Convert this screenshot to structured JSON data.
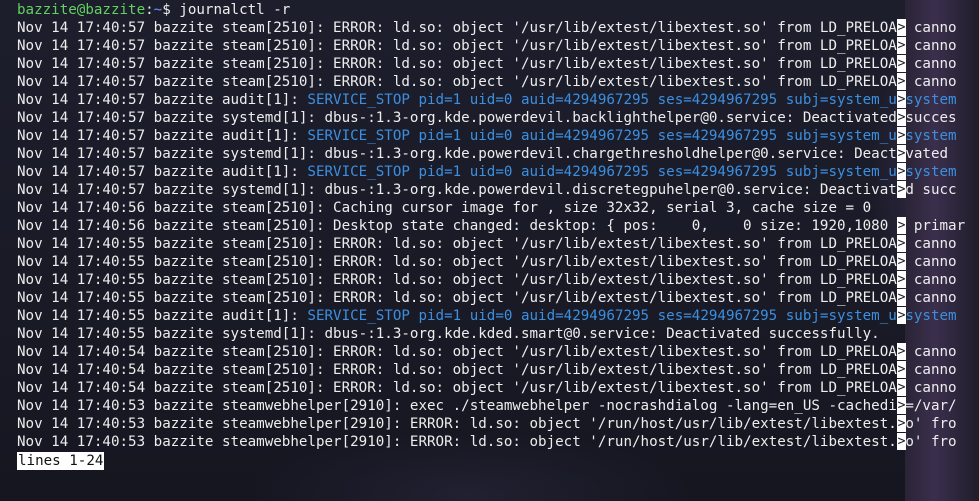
{
  "prompt": {
    "user_host": "bazzite@bazzite",
    "separator": ":",
    "path": "~",
    "symbol": "$",
    "command": " journalctl -r"
  },
  "truncation_marker": ">",
  "log_lines": [
    {
      "prefix": "Nov 14 17:40:57 bazzite steam[2510]: ",
      "message": "ERROR: ld.so: object '/usr/lib/extest/libextest.so' from LD_PRELOAD canno",
      "highlight": false
    },
    {
      "prefix": "Nov 14 17:40:57 bazzite steam[2510]: ",
      "message": "ERROR: ld.so: object '/usr/lib/extest/libextest.so' from LD_PRELOAD canno",
      "highlight": false
    },
    {
      "prefix": "Nov 14 17:40:57 bazzite steam[2510]: ",
      "message": "ERROR: ld.so: object '/usr/lib/extest/libextest.so' from LD_PRELOAD canno",
      "highlight": false
    },
    {
      "prefix": "Nov 14 17:40:57 bazzite steam[2510]: ",
      "message": "ERROR: ld.so: object '/usr/lib/extest/libextest.so' from LD_PRELOAD canno",
      "highlight": false
    },
    {
      "prefix": "Nov 14 17:40:57 bazzite audit[1]: ",
      "message": "SERVICE_STOP pid=1 uid=0 auid=4294967295 ses=4294967295 subj=system_u:system",
      "highlight": true
    },
    {
      "prefix": "Nov 14 17:40:57 bazzite systemd[1]: ",
      "message": "dbus-:1.3-org.kde.powerdevil.backlighthelper@0.service: Deactivated succes",
      "highlight": false
    },
    {
      "prefix": "Nov 14 17:40:57 bazzite audit[1]: ",
      "message": "SERVICE_STOP pid=1 uid=0 auid=4294967295 ses=4294967295 subj=system_u:system",
      "highlight": true
    },
    {
      "prefix": "Nov 14 17:40:57 bazzite systemd[1]: ",
      "message": "dbus-:1.3-org.kde.powerdevil.chargethresholdhelper@0.service: Deactivated ",
      "highlight": false
    },
    {
      "prefix": "Nov 14 17:40:57 bazzite audit[1]: ",
      "message": "SERVICE_STOP pid=1 uid=0 auid=4294967295 ses=4294967295 subj=system_u:system",
      "highlight": true
    },
    {
      "prefix": "Nov 14 17:40:57 bazzite systemd[1]: ",
      "message": "dbus-:1.3-org.kde.powerdevil.discretegpuhelper@0.service: Deactivated succ",
      "highlight": false
    },
    {
      "prefix": "Nov 14 17:40:56 bazzite steam[2510]: ",
      "message": "Caching cursor image for , size 32x32, serial 3, cache size = 0",
      "highlight": false,
      "no_trunc": true
    },
    {
      "prefix": "Nov 14 17:40:56 bazzite steam[2510]: ",
      "message": "Desktop state changed: desktop: { pos:    0,    0 size: 1920,1080 } primar",
      "highlight": false
    },
    {
      "prefix": "Nov 14 17:40:55 bazzite steam[2510]: ",
      "message": "ERROR: ld.so: object '/usr/lib/extest/libextest.so' from LD_PRELOAD canno",
      "highlight": false
    },
    {
      "prefix": "Nov 14 17:40:55 bazzite steam[2510]: ",
      "message": "ERROR: ld.so: object '/usr/lib/extest/libextest.so' from LD_PRELOAD canno",
      "highlight": false
    },
    {
      "prefix": "Nov 14 17:40:55 bazzite steam[2510]: ",
      "message": "ERROR: ld.so: object '/usr/lib/extest/libextest.so' from LD_PRELOAD canno",
      "highlight": false
    },
    {
      "prefix": "Nov 14 17:40:55 bazzite steam[2510]: ",
      "message": "ERROR: ld.so: object '/usr/lib/extest/libextest.so' from LD_PRELOAD canno",
      "highlight": false
    },
    {
      "prefix": "Nov 14 17:40:55 bazzite audit[1]: ",
      "message": "SERVICE_STOP pid=1 uid=0 auid=4294967295 ses=4294967295 subj=system_u:system",
      "highlight": true
    },
    {
      "prefix": "Nov 14 17:40:55 bazzite systemd[1]: ",
      "message": "dbus-:1.3-org.kde.kded.smart@0.service: Deactivated successfully.",
      "highlight": false,
      "no_trunc": true
    },
    {
      "prefix": "Nov 14 17:40:54 bazzite steam[2510]: ",
      "message": "ERROR: ld.so: object '/usr/lib/extest/libextest.so' from LD_PRELOAD canno",
      "highlight": false
    },
    {
      "prefix": "Nov 14 17:40:54 bazzite steam[2510]: ",
      "message": "ERROR: ld.so: object '/usr/lib/extest/libextest.so' from LD_PRELOAD canno",
      "highlight": false
    },
    {
      "prefix": "Nov 14 17:40:54 bazzite steam[2510]: ",
      "message": "ERROR: ld.so: object '/usr/lib/extest/libextest.so' from LD_PRELOAD canno",
      "highlight": false
    },
    {
      "prefix": "Nov 14 17:40:53 bazzite steamwebhelper[2910]: ",
      "message": "exec ./steamwebhelper -nocrashdialog -lang=en_US -cachedir=/var/",
      "highlight": false
    },
    {
      "prefix": "Nov 14 17:40:53 bazzite steamwebhelper[2910]: ",
      "message": "ERROR: ld.so: object '/run/host/usr/lib/extest/libextest.so' fro",
      "highlight": false
    },
    {
      "prefix": "Nov 14 17:40:53 bazzite steamwebhelper[2910]: ",
      "message": "ERROR: ld.so: object '/run/host/usr/lib/extest/libextest.so' fro",
      "highlight": false
    }
  ],
  "status_line": "lines 1-24"
}
